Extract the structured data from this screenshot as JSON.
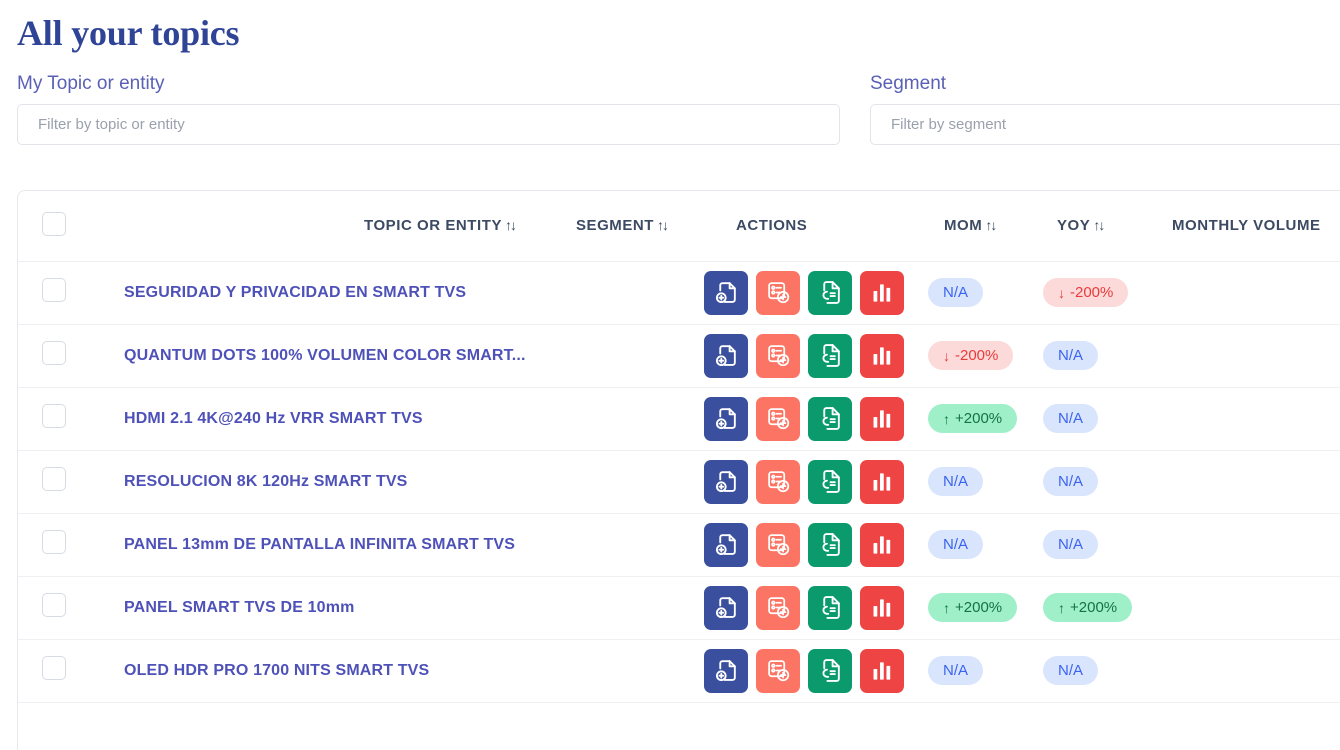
{
  "page": {
    "title": "All your topics"
  },
  "filters": {
    "topic": {
      "label": "My Topic or entity",
      "placeholder": "Filter by topic or entity",
      "value": ""
    },
    "segment": {
      "label": "Segment",
      "placeholder": "Filter by segment",
      "value": ""
    }
  },
  "table": {
    "sort_icon": "↑↓",
    "headers": {
      "topic": "TOPIC OR ENTITY",
      "segment": "SEGMENT",
      "actions": "ACTIONS",
      "mom": "MOM",
      "yoy": "YOY",
      "volume": "MONTHLY VOLUME"
    },
    "actions": [
      {
        "name": "add-document",
        "color": "#3a4f9e"
      },
      {
        "name": "add-report",
        "color": "#fc7464"
      },
      {
        "name": "link-document",
        "color": "#0a9a6c"
      },
      {
        "name": "bar-chart",
        "color": "#ef4444"
      }
    ],
    "rows": [
      {
        "topic": "SEGURIDAD Y PRIVACIDAD EN SMART TVS",
        "segment": "",
        "mom": {
          "text": "N/A",
          "type": "na",
          "arrow": ""
        },
        "yoy": {
          "text": "-200%",
          "type": "down",
          "arrow": "↓"
        },
        "volume": ""
      },
      {
        "topic": "QUANTUM DOTS 100% VOLUMEN COLOR SMART...",
        "segment": "",
        "mom": {
          "text": "-200%",
          "type": "down",
          "arrow": "↓"
        },
        "yoy": {
          "text": "N/A",
          "type": "na",
          "arrow": ""
        },
        "volume": ""
      },
      {
        "topic": "HDMI 2.1 4K@240 Hz VRR SMART TVS",
        "segment": "",
        "mom": {
          "text": "+200%",
          "type": "up",
          "arrow": "↑"
        },
        "yoy": {
          "text": "N/A",
          "type": "na",
          "arrow": ""
        },
        "volume": ""
      },
      {
        "topic": "RESOLUCION 8K 120Hz SMART TVS",
        "segment": "",
        "mom": {
          "text": "N/A",
          "type": "na",
          "arrow": ""
        },
        "yoy": {
          "text": "N/A",
          "type": "na",
          "arrow": ""
        },
        "volume": ""
      },
      {
        "topic": "PANEL 13mm DE PANTALLA INFINITA SMART TVS",
        "segment": "",
        "mom": {
          "text": "N/A",
          "type": "na",
          "arrow": ""
        },
        "yoy": {
          "text": "N/A",
          "type": "na",
          "arrow": ""
        },
        "volume": ""
      },
      {
        "topic": "PANEL SMART TVS DE 10mm",
        "segment": "",
        "mom": {
          "text": "+200%",
          "type": "up",
          "arrow": "↑"
        },
        "yoy": {
          "text": "+200%",
          "type": "up",
          "arrow": "↑"
        },
        "volume": ""
      },
      {
        "topic": "OLED HDR PRO 1700 NITS SMART TVS",
        "segment": "",
        "mom": {
          "text": "N/A",
          "type": "na",
          "arrow": ""
        },
        "yoy": {
          "text": "N/A",
          "type": "na",
          "arrow": ""
        },
        "volume": ""
      }
    ]
  },
  "colors": {
    "title": "#2f4496",
    "label": "#5a61b5",
    "topic_link": "#4e51b8",
    "header_text": "#3c4a63",
    "badge_na_bg": "#d9e5fd",
    "badge_na_fg": "#3a64f0",
    "badge_up_bg": "#9ff0c8",
    "badge_up_fg": "#14714a",
    "badge_down_bg": "#fcdada",
    "badge_down_fg": "#e93b3b"
  }
}
